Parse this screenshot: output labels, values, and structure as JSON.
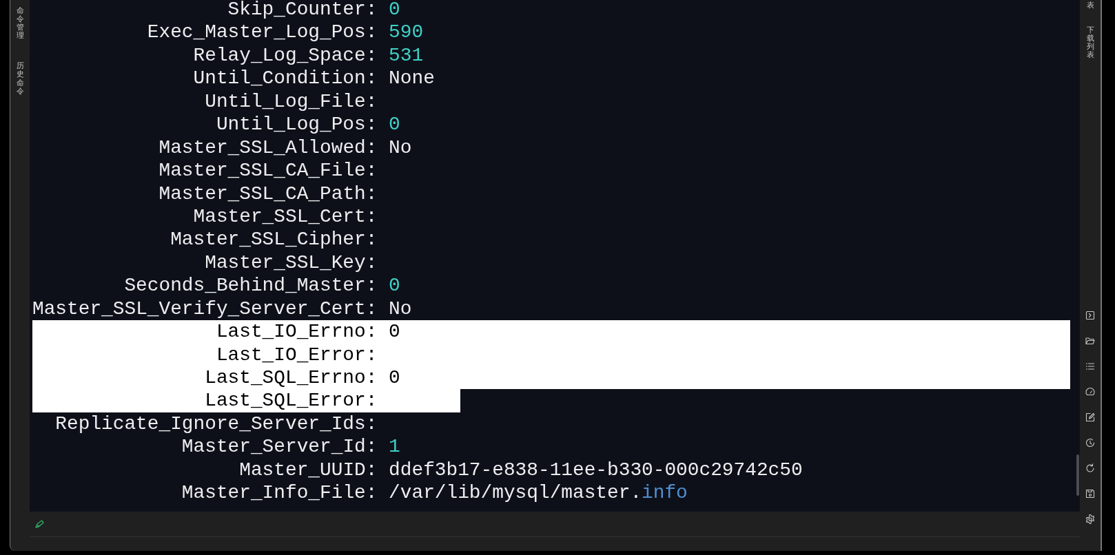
{
  "left_sidebar": {
    "items": [
      {
        "label": "命令管理"
      },
      {
        "label": "历史命令"
      }
    ]
  },
  "right_sidebar": {
    "tabs": [
      {
        "label": "表"
      },
      {
        "label": "下载列表"
      }
    ]
  },
  "terminal": {
    "rows": [
      {
        "label": "Skip_Counter:",
        "value": [
          {
            "text": "0",
            "kind": "number"
          }
        ],
        "selected": false
      },
      {
        "label": "Exec_Master_Log_Pos:",
        "value": [
          {
            "text": "590",
            "kind": "number"
          }
        ],
        "selected": false
      },
      {
        "label": "Relay_Log_Space:",
        "value": [
          {
            "text": "531",
            "kind": "number"
          }
        ],
        "selected": false
      },
      {
        "label": "Until_Condition:",
        "value": [
          {
            "text": "None",
            "kind": "plain"
          }
        ],
        "selected": false
      },
      {
        "label": "Until_Log_File:",
        "value": [],
        "selected": false
      },
      {
        "label": "Until_Log_Pos:",
        "value": [
          {
            "text": "0",
            "kind": "number"
          }
        ],
        "selected": false
      },
      {
        "label": "Master_SSL_Allowed:",
        "value": [
          {
            "text": "No",
            "kind": "plain"
          }
        ],
        "selected": false
      },
      {
        "label": "Master_SSL_CA_File:",
        "value": [],
        "selected": false
      },
      {
        "label": "Master_SSL_CA_Path:",
        "value": [],
        "selected": false
      },
      {
        "label": "Master_SSL_Cert:",
        "value": [],
        "selected": false
      },
      {
        "label": "Master_SSL_Cipher:",
        "value": [],
        "selected": false
      },
      {
        "label": "Master_SSL_Key:",
        "value": [],
        "selected": false
      },
      {
        "label": "Seconds_Behind_Master:",
        "value": [
          {
            "text": "0",
            "kind": "number"
          }
        ],
        "selected": false
      },
      {
        "label": "Master_SSL_Verify_Server_Cert:",
        "value": [
          {
            "text": "No",
            "kind": "plain"
          }
        ],
        "selected": false
      },
      {
        "label": "Last_IO_Errno:",
        "value": [
          {
            "text": "0",
            "kind": "number"
          }
        ],
        "selected": true
      },
      {
        "label": "Last_IO_Error:",
        "value": [],
        "selected": true
      },
      {
        "label": "Last_SQL_Errno:",
        "value": [
          {
            "text": "0",
            "kind": "number"
          }
        ],
        "selected": true
      },
      {
        "label": "Last_SQL_Error:",
        "value": [],
        "selected": true
      },
      {
        "label": "Replicate_Ignore_Server_Ids:",
        "value": [],
        "selected": false
      },
      {
        "label": "Master_Server_Id:",
        "value": [
          {
            "text": "1",
            "kind": "number"
          }
        ],
        "selected": false
      },
      {
        "label": "Master_UUID:",
        "value": [
          {
            "text": "ddef3b17-e838-11ee-b330-000c29742c50",
            "kind": "plain"
          }
        ],
        "selected": false
      },
      {
        "label": "Master_Info_File:",
        "value": [
          {
            "text": "/var/lib/mysql/master.",
            "kind": "plain"
          },
          {
            "text": "info",
            "kind": "extension"
          }
        ],
        "selected": false
      }
    ]
  }
}
